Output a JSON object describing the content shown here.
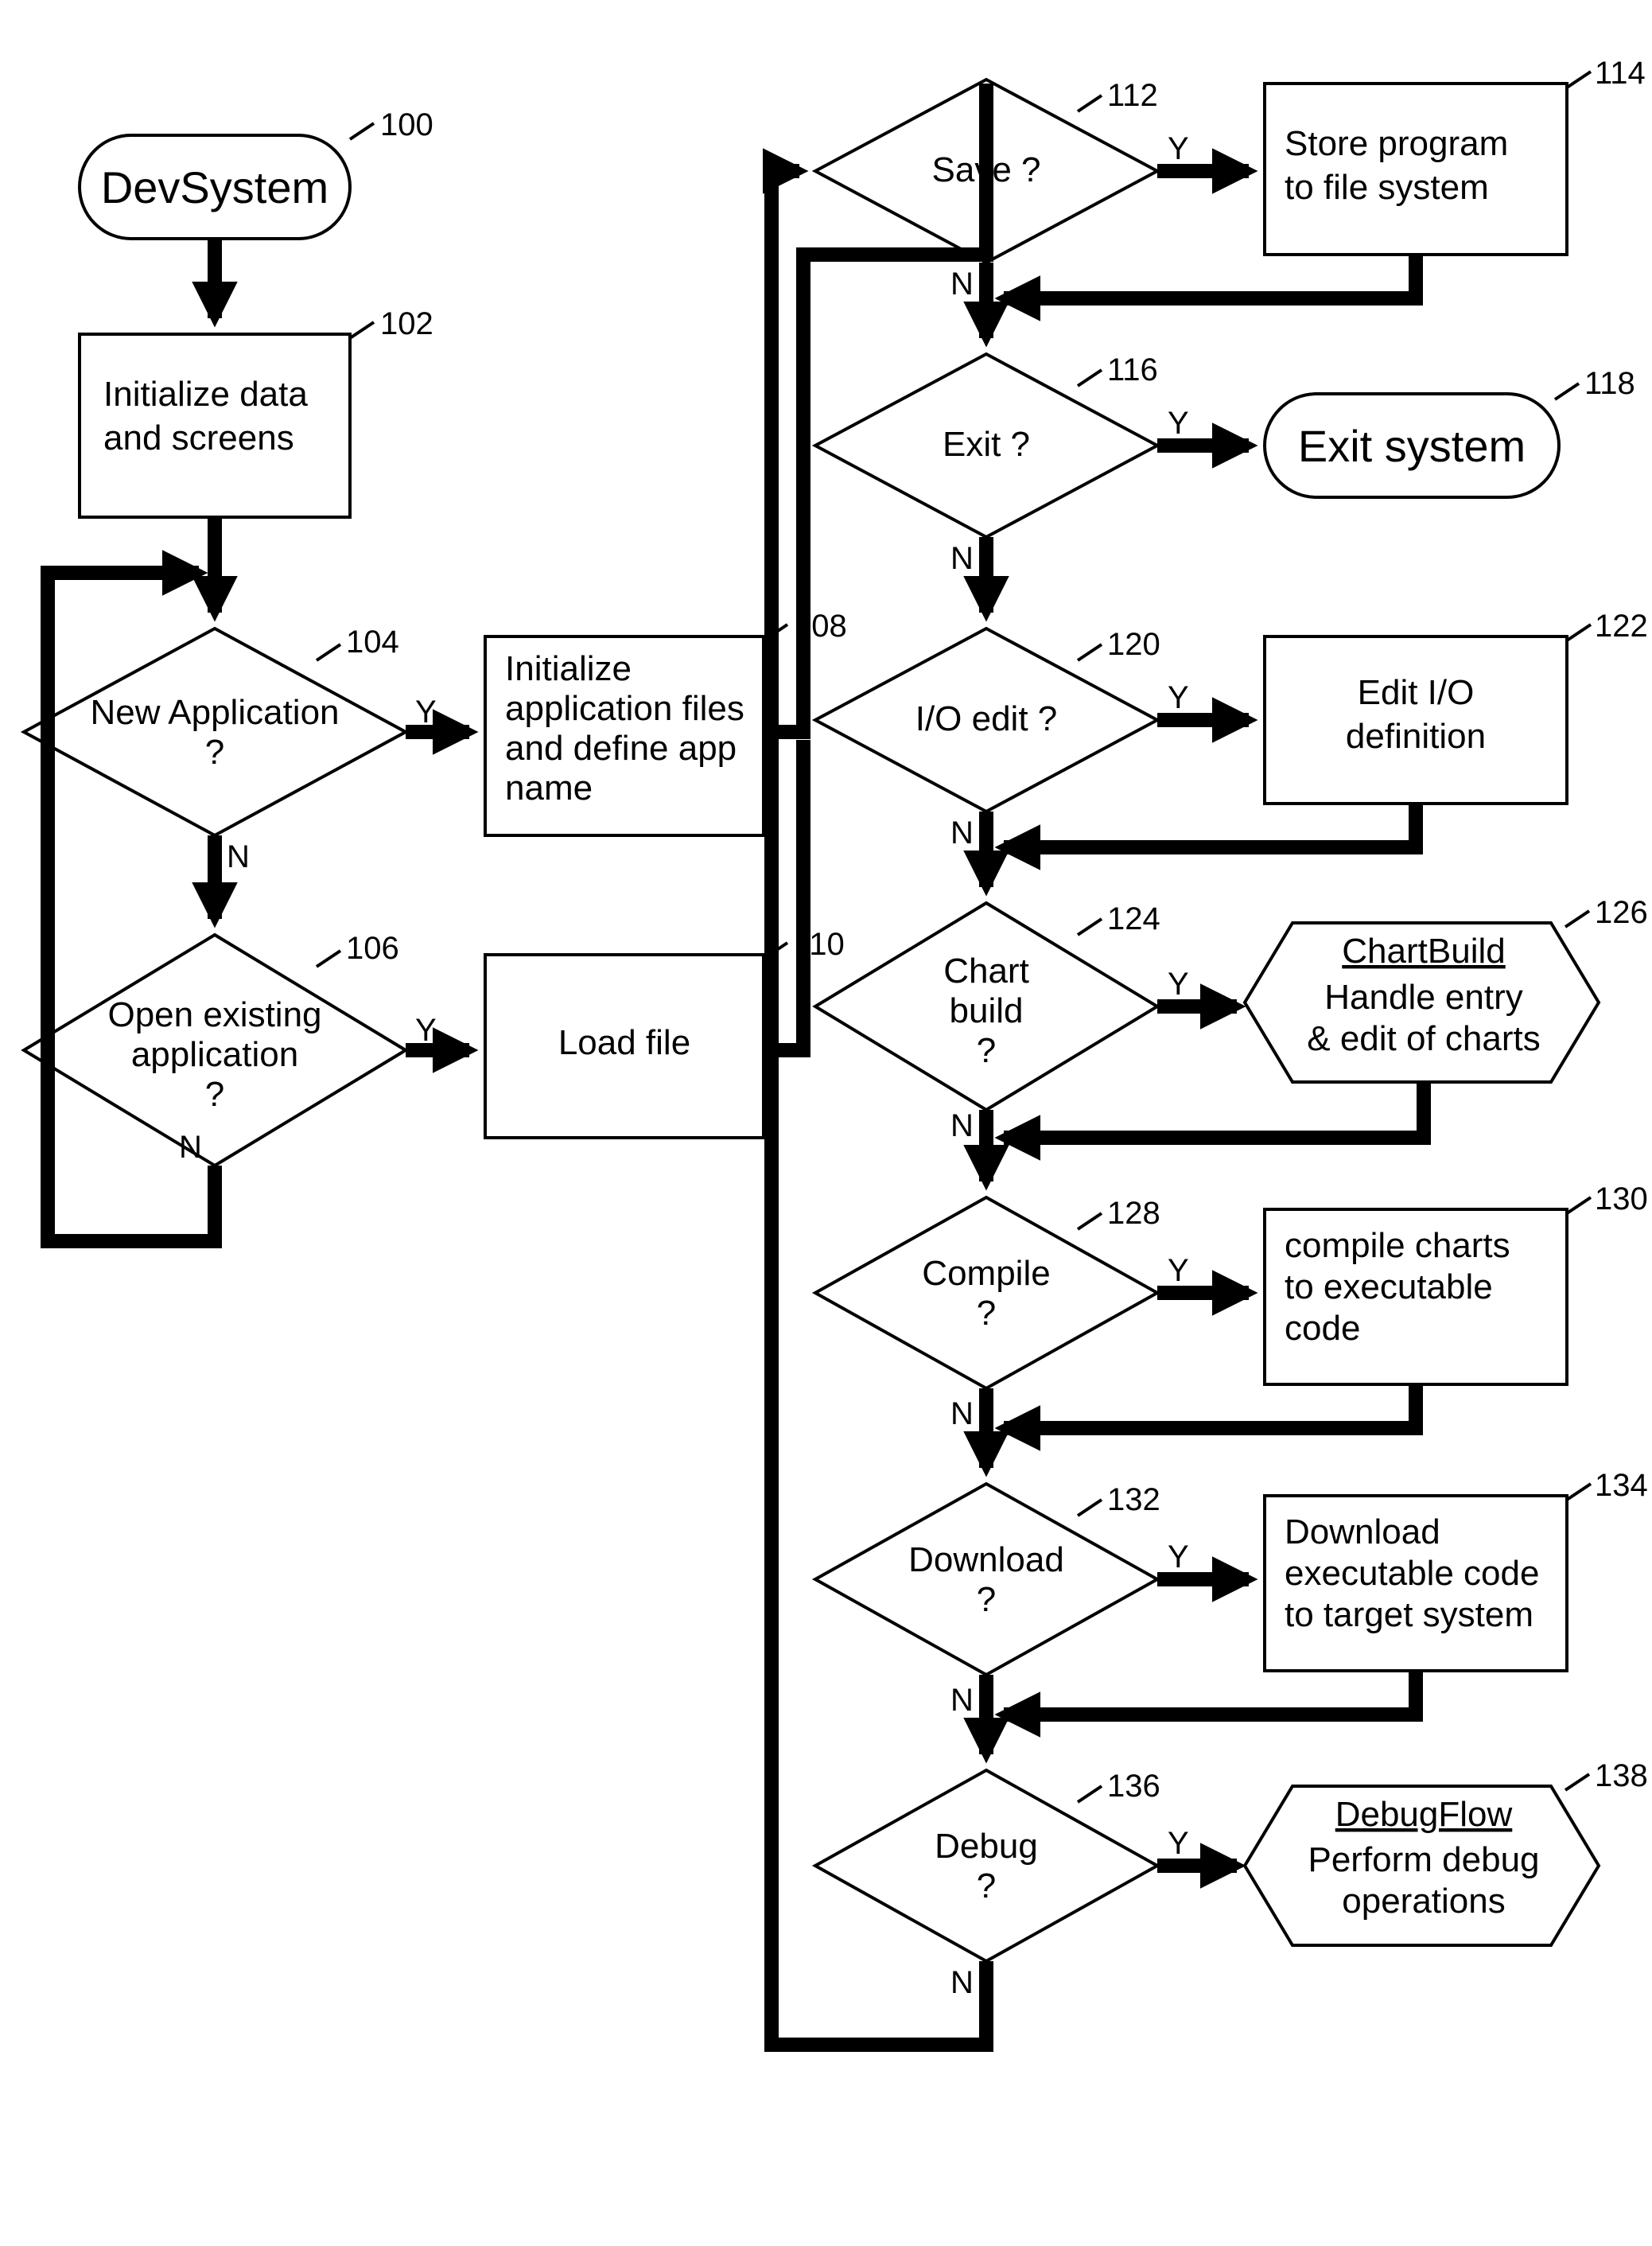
{
  "start": {
    "label": "DevSystem",
    "ref": "100"
  },
  "process": {
    "init": {
      "ref": "102",
      "l1": "Initialize data",
      "l2": "and screens"
    },
    "initApp": {
      "ref": "108",
      "l1": "Initialize",
      "l2": "application files",
      "l3": "and define app",
      "l4": "name"
    },
    "loadFile": {
      "ref": "110",
      "l1": "Load file"
    },
    "store": {
      "ref": "114",
      "l1": "Store program",
      "l2": "to file system"
    },
    "editIO": {
      "ref": "122",
      "l1": "Edit I/O",
      "l2": "definition"
    },
    "compile": {
      "ref": "130",
      "l1": "compile charts",
      "l2": "to executable",
      "l3": "code"
    },
    "download": {
      "ref": "134",
      "l1": "Download",
      "l2": "executable code",
      "l3": "to target system"
    }
  },
  "decision": {
    "newApp": {
      "ref": "104",
      "l1": "New Application",
      "l2": "?"
    },
    "openApp": {
      "ref": "106",
      "l1": "Open existing",
      "l2": "application",
      "l3": "?"
    },
    "save": {
      "ref": "112",
      "l1": "Save ?"
    },
    "exit": {
      "ref": "116",
      "l1": "Exit ?"
    },
    "ioEdit": {
      "ref": "120",
      "l1": "I/O edit ?"
    },
    "chart": {
      "ref": "124",
      "l1": "Chart",
      "l2": "build",
      "l3": "?"
    },
    "compile": {
      "ref": "128",
      "l1": "Compile",
      "l2": "?"
    },
    "download": {
      "ref": "132",
      "l1": "Download",
      "l2": "?"
    },
    "debug": {
      "ref": "136",
      "l1": "Debug",
      "l2": "?"
    }
  },
  "sub": {
    "chartBuild": {
      "ref": "126",
      "title": "ChartBuild",
      "l1": "Handle entry",
      "l2": "& edit of charts"
    },
    "debugFlow": {
      "ref": "138",
      "title": "DebugFlow",
      "l1": "Perform debug",
      "l2": "operations"
    }
  },
  "terminator": {
    "exit": {
      "ref": "118",
      "l1": "Exit system"
    }
  },
  "labels": {
    "yes": "Y",
    "no": "N"
  }
}
